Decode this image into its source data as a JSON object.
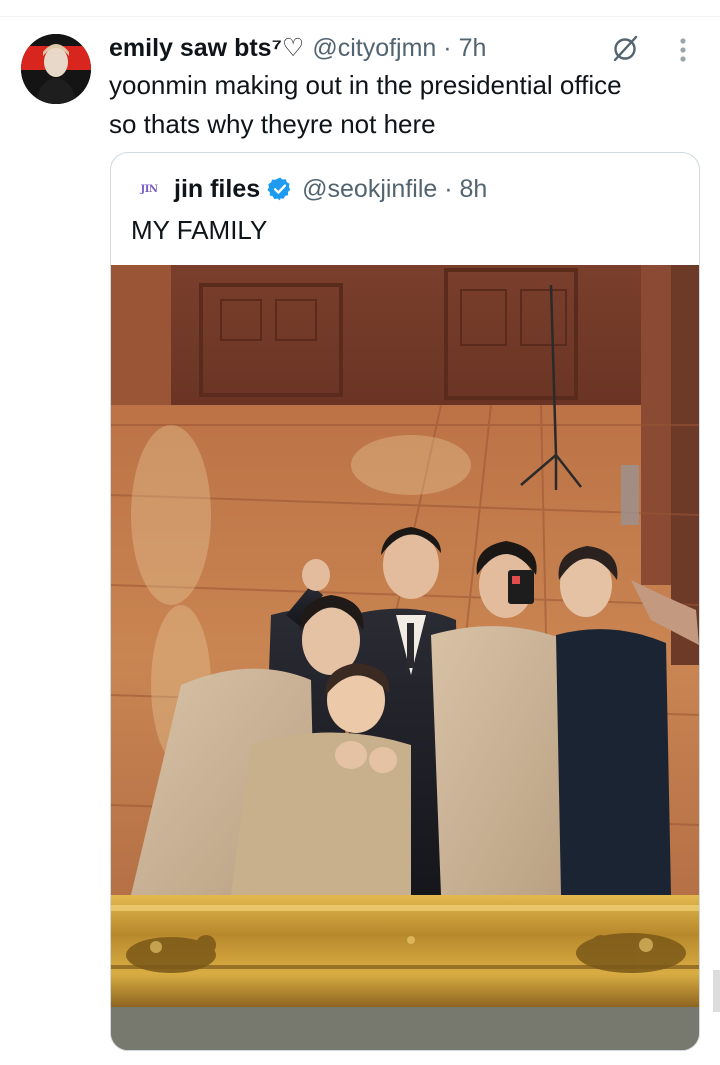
{
  "tweet": {
    "author_name": "emily saw bts⁷",
    "heart_symbol": "♡",
    "handle": "@cityofjmn",
    "separator": "·",
    "time": "7h",
    "text_line1": "yoonmin making out in the presidential office",
    "text_line2": "so thats why theyre not here"
  },
  "icons": {
    "avatar": "profile-avatar",
    "grok": "grok-explain-icon",
    "more": "more-options-icon",
    "verified": "verified-badge-icon"
  },
  "quote": {
    "avatar_label": "JIN",
    "author_name": "jin files",
    "handle": "@seokjinfile",
    "separator": "·",
    "time": "8h",
    "text": "MY FAMILY",
    "photo": "group-mirror-selfie-photo"
  },
  "colors": {
    "text_primary": "#0f1419",
    "text_secondary": "#536471",
    "verified_blue": "#1d9bf0",
    "border": "#cfd9de"
  }
}
